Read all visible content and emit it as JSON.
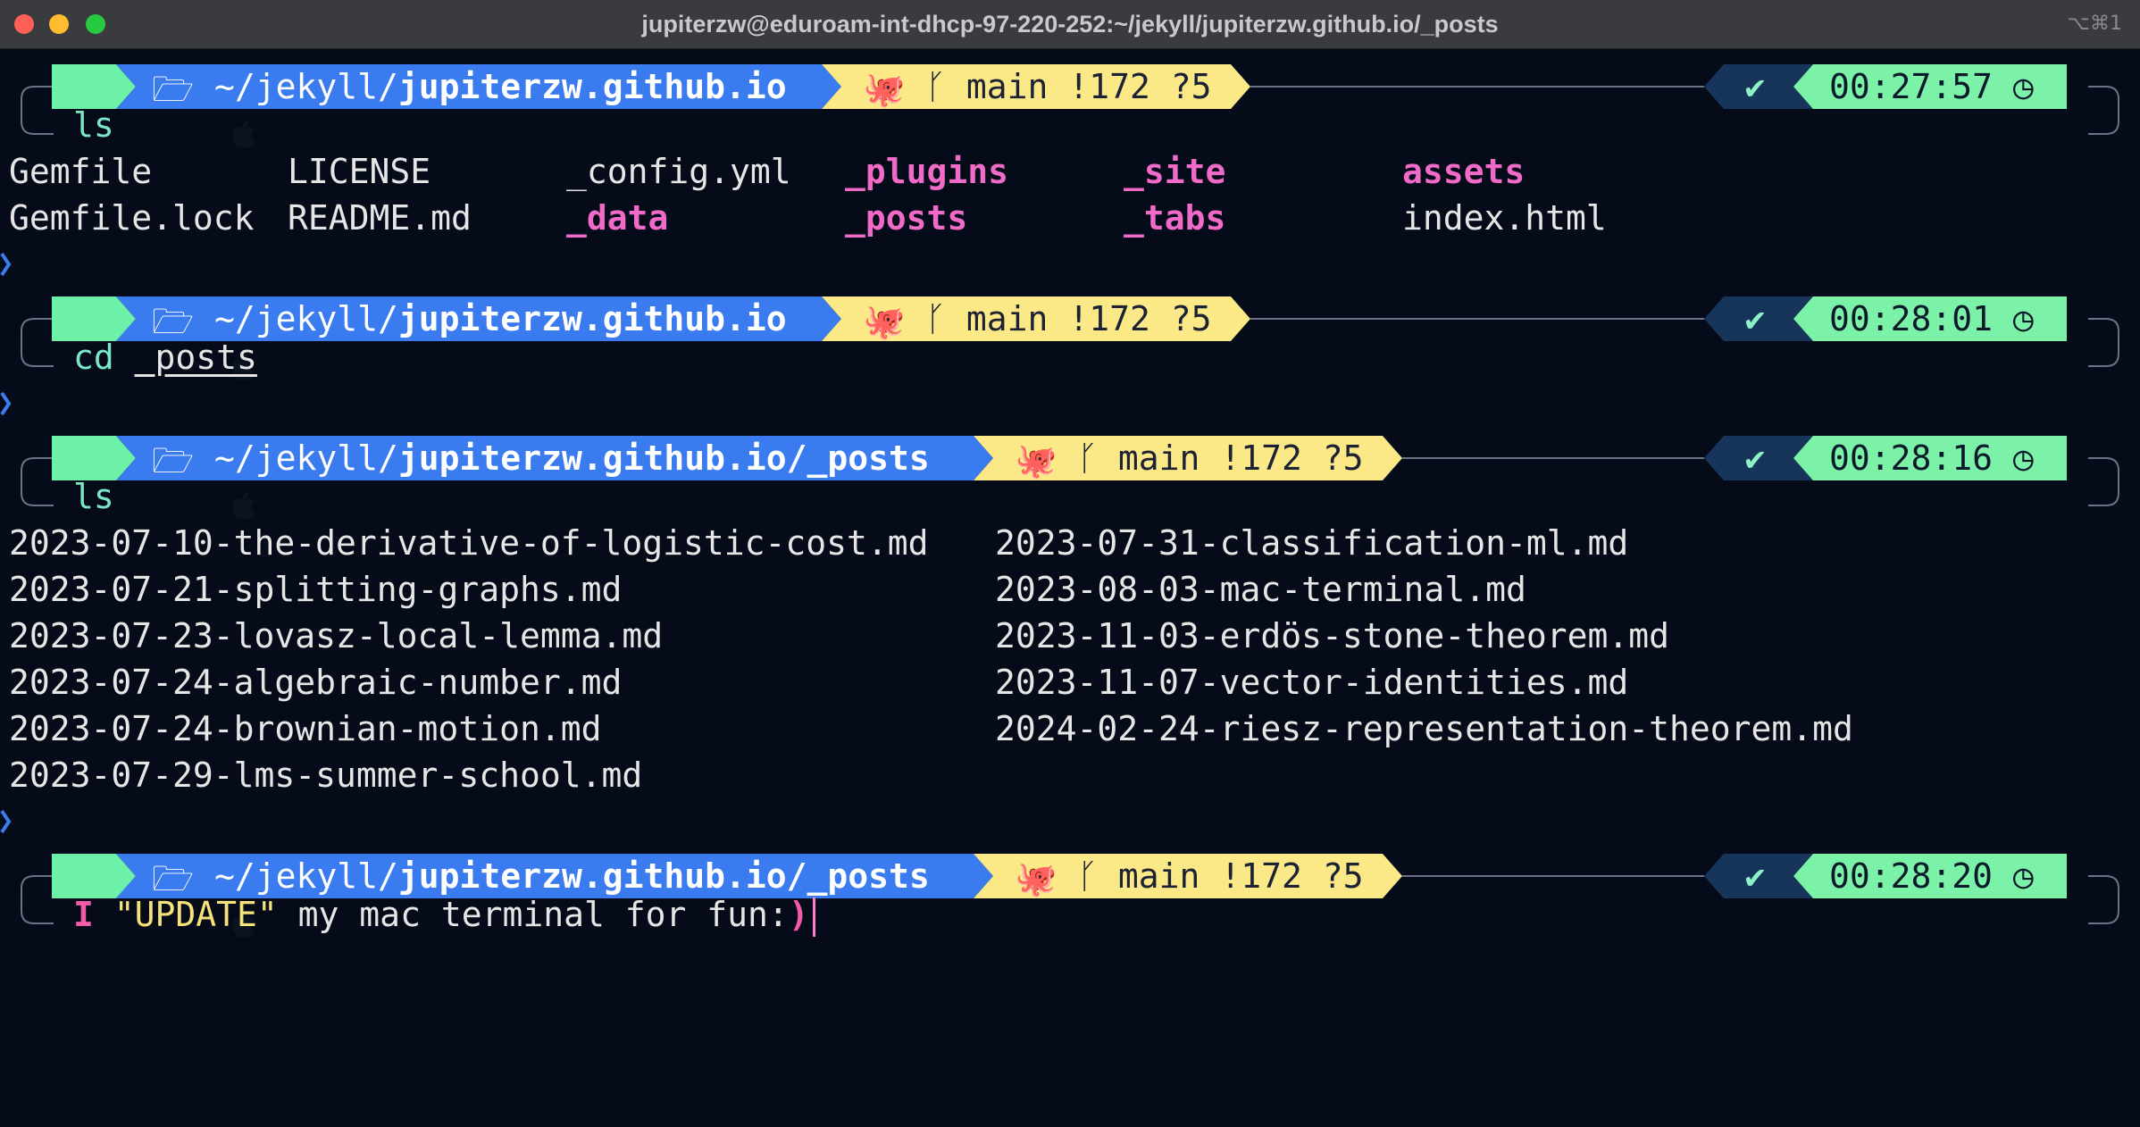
{
  "window": {
    "title": "jupiterzw@eduroam-int-dhcp-97-220-252:~/jekyll/jupiterzw.github.io/_posts",
    "shortcut": "⌥⌘1"
  },
  "colors": {
    "background": "#050b18",
    "os_segment": "#6df0a8",
    "path_segment": "#3a7bf0",
    "git_segment": "#fbe887",
    "status_segment": "#17345a",
    "time_segment": "#7cf2a8",
    "dir_color": "#f06ac8",
    "cmd_color": "#79e8c7"
  },
  "prompts": [
    {
      "path_prefix": "~/jekyll/",
      "path_bold": "jupiterzw.github.io",
      "git": "main !172 ?5",
      "status": "✔",
      "time": "00:27:57",
      "cmd": "ls"
    },
    {
      "path_prefix": "~/jekyll/",
      "path_bold": "jupiterzw.github.io",
      "git": "main !172 ?5",
      "status": "✔",
      "time": "00:28:01",
      "cmd_word": "cd",
      "cmd_arg": "_posts"
    },
    {
      "path_prefix": "~/jekyll/",
      "path_bold": "jupiterzw.github.io/_posts",
      "git": "main !172 ?5",
      "status": "✔",
      "time": "00:28:16",
      "cmd": "ls"
    },
    {
      "path_prefix": "~/jekyll/",
      "path_bold": "jupiterzw.github.io/_posts",
      "git": "main !172 ?5",
      "status": "✔",
      "time": "00:28:20",
      "input_p1": "I",
      "input_p2": " \"UPDATE\"",
      "input_p3": " my mac terminal for fun:",
      "input_p4": ")"
    }
  ],
  "ls1": {
    "row1": [
      "Gemfile",
      "LICENSE",
      "_config.yml",
      "_plugins",
      "_site",
      "assets"
    ],
    "row2": [
      "Gemfile.lock",
      "README.md",
      "_data",
      "_posts",
      "_tabs",
      "index.html"
    ]
  },
  "ls2": {
    "left": [
      "2023-07-10-the-derivative-of-logistic-cost.md",
      "2023-07-21-splitting-graphs.md",
      "2023-07-23-lovasz-local-lemma.md",
      "2023-07-24-algebraic-number.md",
      "2023-07-24-brownian-motion.md",
      "2023-07-29-lms-summer-school.md"
    ],
    "right": [
      "2023-07-31-classification-ml.md",
      "2023-08-03-mac-terminal.md",
      "2023-11-03-erdös-stone-theorem.md",
      "2023-11-07-vector-identities.md",
      "2024-02-24-riesz-representation-theorem.md"
    ]
  }
}
